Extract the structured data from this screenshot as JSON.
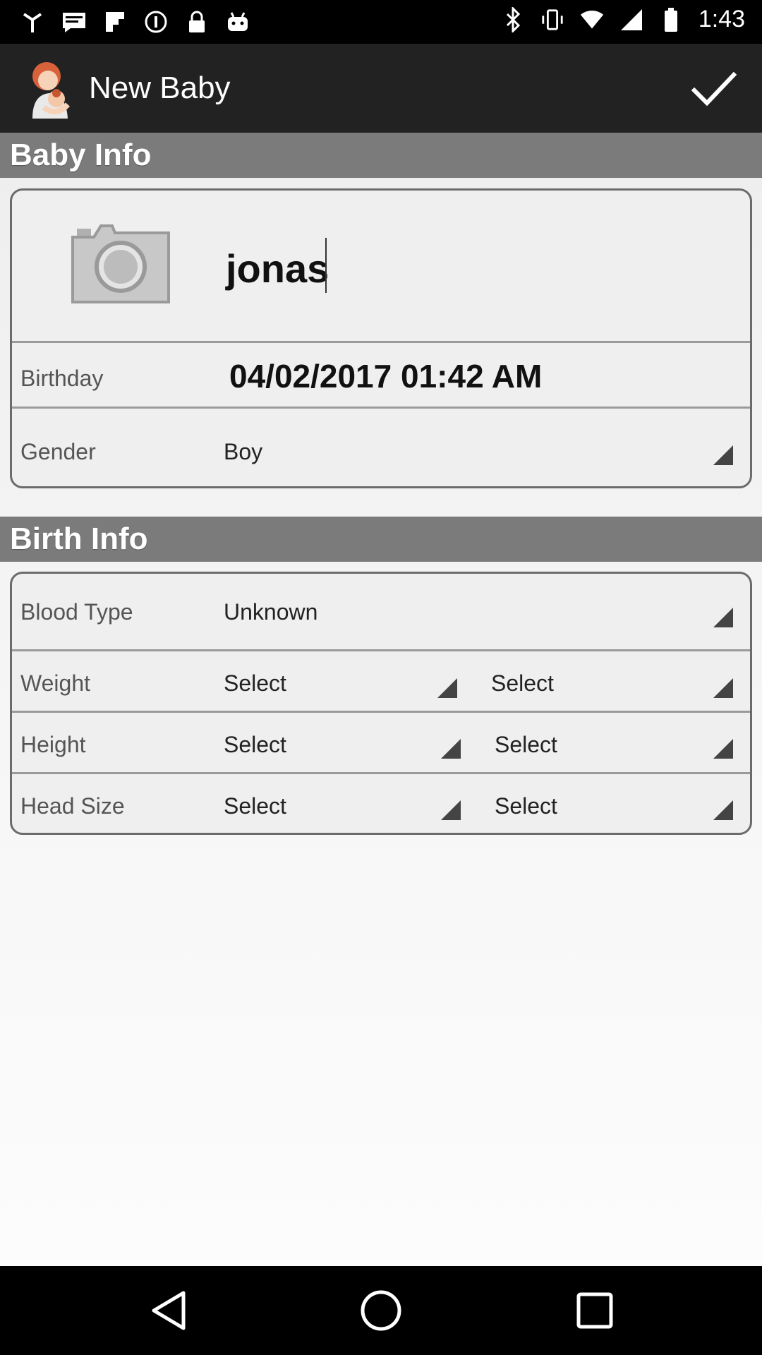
{
  "status_bar": {
    "time": "1:43",
    "icons_left": [
      "signal-icon",
      "message-icon",
      "flipboard-icon",
      "spotify-icon",
      "lock-icon",
      "android-icon"
    ],
    "icons_right": [
      "bluetooth-icon",
      "vibrate-icon",
      "wifi-icon",
      "cellular-icon",
      "battery-icon"
    ]
  },
  "app_bar": {
    "title": "New Baby",
    "confirm_icon": "checkmark-icon"
  },
  "baby_info": {
    "section_title": "Baby Info",
    "photo_icon": "camera-icon",
    "name_value": "jonas",
    "birthday_label": "Birthday",
    "birthday_value": "04/02/2017 01:42 AM",
    "gender_label": "Gender",
    "gender_value": "Boy"
  },
  "birth_info": {
    "section_title": "Birth Info",
    "blood_type_label": "Blood Type",
    "blood_type_value": "Unknown",
    "weight_label": "Weight",
    "weight_value_1": "Select",
    "weight_value_2": "Select",
    "height_label": "Height",
    "height_value_1": "Select",
    "height_value_2": "Select",
    "head_size_label": "Head Size",
    "head_size_value_1": "Select",
    "head_size_value_2": "Select"
  },
  "nav_bar": {
    "back_icon": "back-triangle-icon",
    "home_icon": "home-circle-icon",
    "recents_icon": "recents-square-icon"
  }
}
